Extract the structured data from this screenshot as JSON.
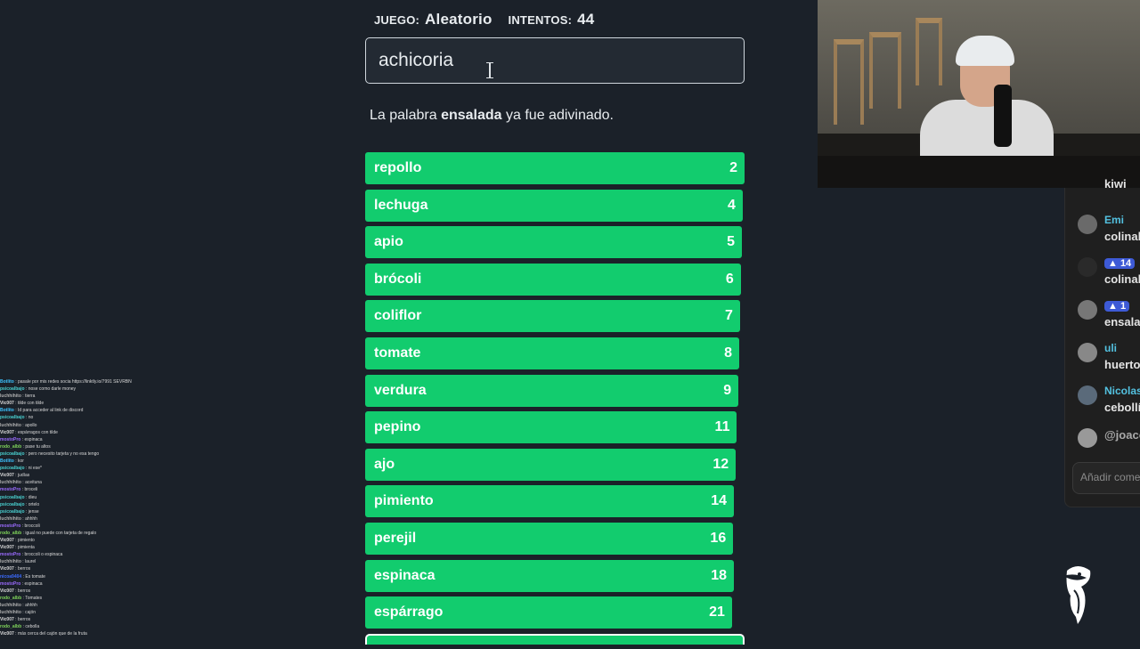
{
  "header": {
    "game_label": "JUEGO:",
    "game_value": "Aleatorio",
    "attempts_label": "INTENTOS:",
    "attempts_value": "44"
  },
  "input": {
    "value": "achicoria"
  },
  "status": {
    "prefix": "La palabra",
    "word": "ensalada",
    "suffix": "ya fue adivinado."
  },
  "guesses": [
    {
      "word": "repollo",
      "rank": "2",
      "fill": 1.0
    },
    {
      "word": "lechuga",
      "rank": "4",
      "fill": 0.995
    },
    {
      "word": "apio",
      "rank": "5",
      "fill": 0.993
    },
    {
      "word": "brócoli",
      "rank": "6",
      "fill": 0.99
    },
    {
      "word": "coliflor",
      "rank": "7",
      "fill": 0.988
    },
    {
      "word": "tomate",
      "rank": "8",
      "fill": 0.986
    },
    {
      "word": "verdura",
      "rank": "9",
      "fill": 0.984
    },
    {
      "word": "pepino",
      "rank": "11",
      "fill": 0.98
    },
    {
      "word": "ajo",
      "rank": "12",
      "fill": 0.977
    },
    {
      "word": "pimiento",
      "rank": "14",
      "fill": 0.972
    },
    {
      "word": "perejil",
      "rank": "16",
      "fill": 0.97
    },
    {
      "word": "espinaca",
      "rank": "18",
      "fill": 0.972
    },
    {
      "word": "espárrago",
      "rank": "21",
      "fill": 0.967
    }
  ],
  "right_chat": {
    "messages": [
      {
        "name": "",
        "badge": "",
        "text": "kiwi"
      },
      {
        "name": "Emi",
        "badge": "",
        "text": "colinab"
      },
      {
        "name": "",
        "badge": "14",
        "text": "colinab"
      },
      {
        "name": "",
        "badge": "1",
        "text": "ensalac"
      },
      {
        "name": "uli",
        "badge": "",
        "text": "huerto"
      },
      {
        "name": "Nicolas",
        "badge": "",
        "text": "cebollí"
      },
      {
        "name": "",
        "badge": "",
        "text": "@joaco"
      }
    ],
    "input_placeholder": "Añadir come"
  },
  "left_chat": [
    {
      "user": "Botlito",
      "color": "#3cc3ff",
      "text": "pasale por mis redes socia https://linktly.io/7991 SEVRBN"
    },
    {
      "user": "psicoalbajo",
      "color": "#49d0d0",
      "text": "nose como darle money"
    },
    {
      "user": "luchhihito",
      "color": "#b0b0b0",
      "text": "tierra"
    },
    {
      "user": "Vic007",
      "color": "#dddddd",
      "text": "tilde con tilde"
    },
    {
      "user": "Botlito",
      "color": "#3cc3ff",
      "text": "Id para acceder al link de discord"
    },
    {
      "user": "psicoalbajo",
      "color": "#49d0d0",
      "text": "no"
    },
    {
      "user": "luchhihito",
      "color": "#b0b0b0",
      "text": "apollo"
    },
    {
      "user": "Vic007",
      "color": "#dddddd",
      "text": "espárragos con tilde"
    },
    {
      "user": "mostoPro",
      "color": "#9b6bff",
      "text": "espinaca"
    },
    {
      "user": "rodo_albb",
      "color": "#7fd35a",
      "text": "pase tu altos"
    },
    {
      "user": "psicoalbajo",
      "color": "#49d0d0",
      "text": "pero necesito tarjeta y no esa tengo"
    },
    {
      "user": "Botlito",
      "color": "#3cc3ff",
      "text": "kor"
    },
    {
      "user": "psicoalbajo",
      "color": "#49d0d0",
      "text": "ni ese*"
    },
    {
      "user": "Vic007",
      "color": "#dddddd",
      "text": "judías"
    },
    {
      "user": "luchhihito",
      "color": "#b0b0b0",
      "text": "aceituna"
    },
    {
      "user": "mostoPro",
      "color": "#9b6bff",
      "text": "broceli"
    },
    {
      "user": "psicoalbajo",
      "color": "#49d0d0",
      "text": "dieu"
    },
    {
      "user": "psicoalbajo",
      "color": "#49d0d0",
      "text": "ortelo"
    },
    {
      "user": "psicoalbajo",
      "color": "#49d0d0",
      "text": "jense"
    },
    {
      "user": "luchhihito",
      "color": "#b0b0b0",
      "text": "ahhhh"
    },
    {
      "user": "mostoPro",
      "color": "#9b6bff",
      "text": "broccoli"
    },
    {
      "user": "rodo_albb",
      "color": "#7fd35a",
      "text": "igual no puede con tarjeta de regalo"
    },
    {
      "user": "Vic007",
      "color": "#dddddd",
      "text": "pimiento"
    },
    {
      "user": "Vic007",
      "color": "#dddddd",
      "text": "pimienta"
    },
    {
      "user": "mostoPro",
      "color": "#9b6bff",
      "text": "broccoli o espinaca"
    },
    {
      "user": "luchhihito",
      "color": "#b0b0b0",
      "text": "laurel"
    },
    {
      "user": "Vic007",
      "color": "#dddddd",
      "text": "berros"
    },
    {
      "user": "nicoa9404",
      "color": "#3b6bff",
      "text": "Es tomate"
    },
    {
      "user": "mostoPro",
      "color": "#9b6bff",
      "text": "espinaca"
    },
    {
      "user": "Vic007",
      "color": "#dddddd",
      "text": "berros"
    },
    {
      "user": "rodo_albb",
      "color": "#7fd35a",
      "text": "Tomates"
    },
    {
      "user": "luchhihito",
      "color": "#b0b0b0",
      "text": "ahhhh"
    },
    {
      "user": "luchhihito",
      "color": "#b0b0b0",
      "text": "cajón"
    },
    {
      "user": "Vic007",
      "color": "#dddddd",
      "text": "berros"
    },
    {
      "user": "rodo_albb",
      "color": "#7fd35a",
      "text": "cebolla"
    },
    {
      "user": "Vic007",
      "color": "#dddddd",
      "text": "más cerca del cajón que de la fruta"
    }
  ],
  "colors": {
    "background": "#1b2129",
    "guess_bar": "#12cc6e",
    "username_blue": "#53c1e0",
    "badge_blue": "#3d5ad6"
  },
  "icons": [
    "text-cursor-icon",
    "toucan-logo-icon"
  ]
}
